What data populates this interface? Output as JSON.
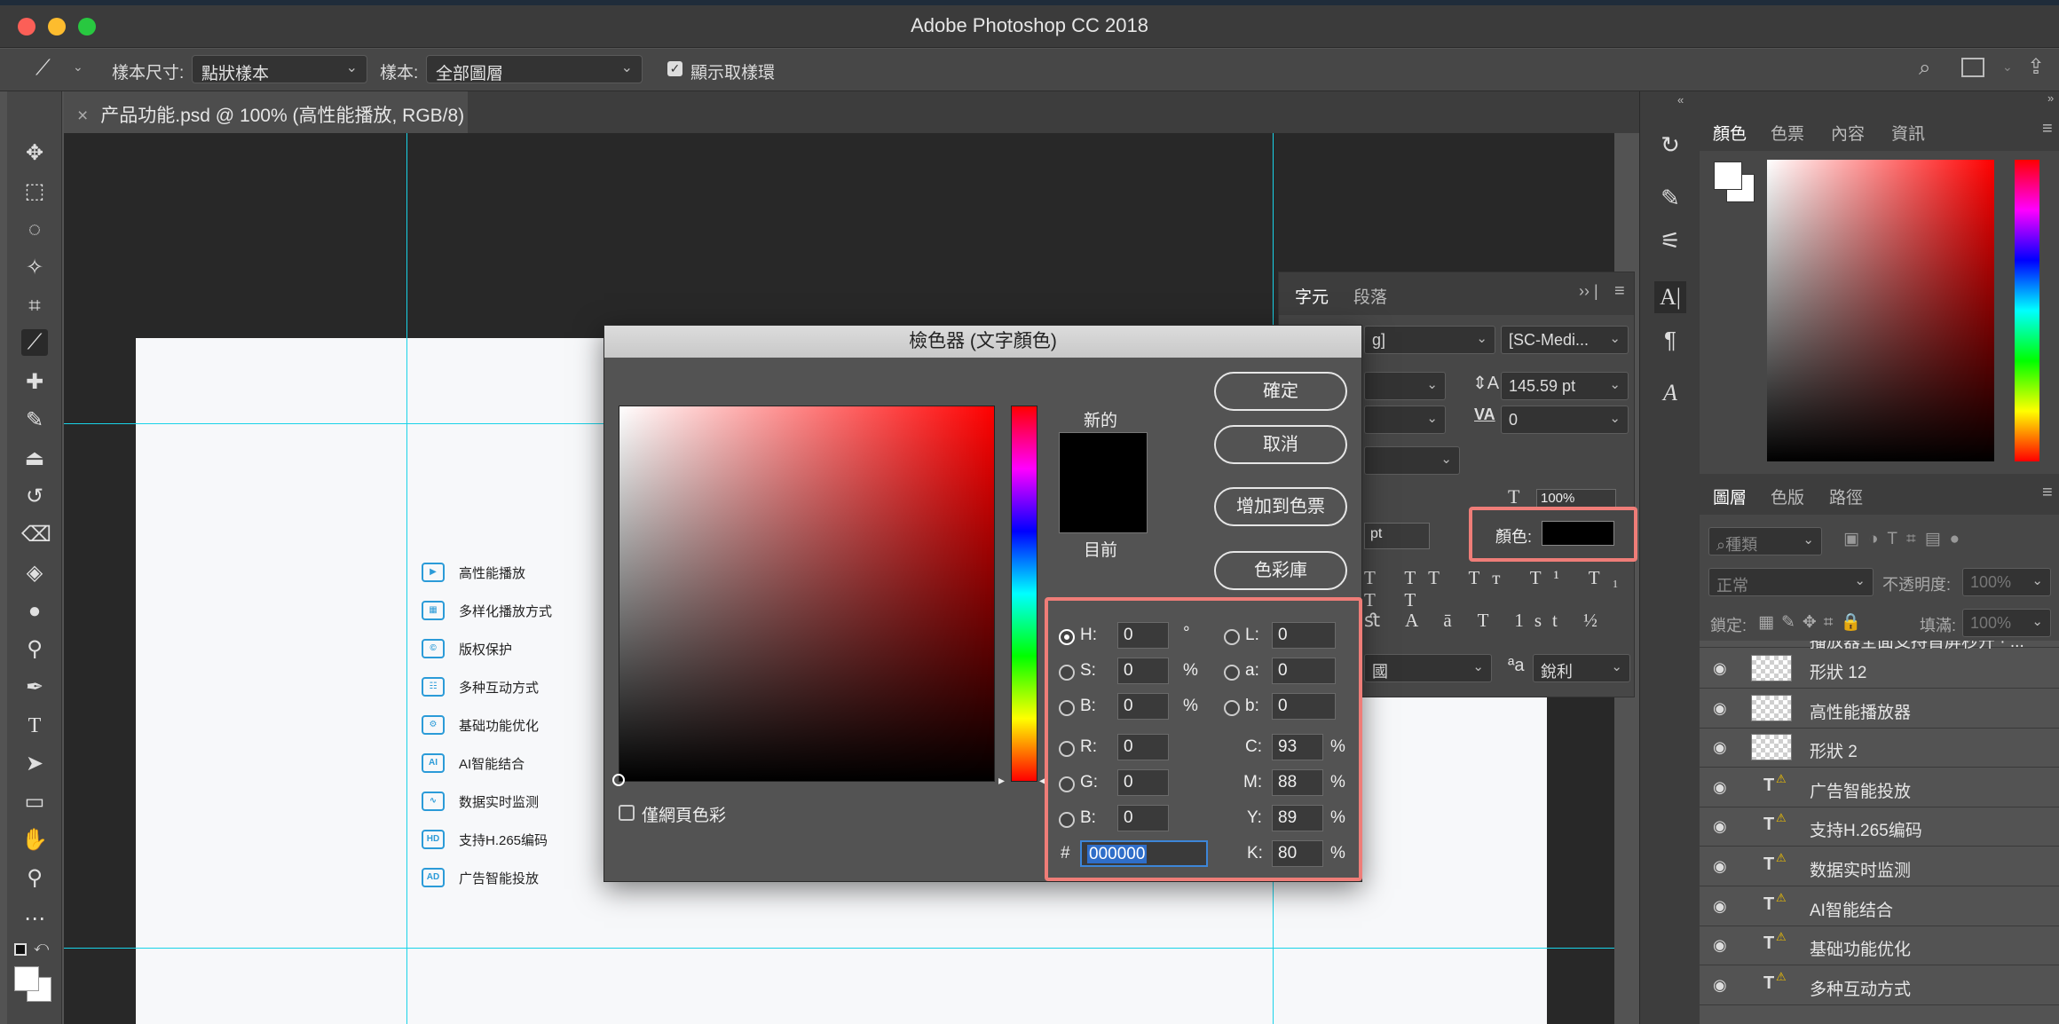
{
  "app_title": "Adobe Photoshop CC 2018",
  "options_bar": {
    "sample_size_label": "樣本尺寸:",
    "sample_size_value": "點狀樣本",
    "sample_label": "樣本:",
    "sample_value": "全部圖層",
    "show_ring_label": "顯示取樣環"
  },
  "document_tab": "产品功能.psd @ 100% (高性能播放, RGB/8)",
  "features": [
    {
      "icon": "▶",
      "label": "高性能播放"
    },
    {
      "icon": "▦",
      "label": "多样化播放方式"
    },
    {
      "icon": "©",
      "label": "版权保护"
    },
    {
      "icon": "☷",
      "label": "多种互动方式"
    },
    {
      "icon": "⚙",
      "label": "基础功能优化"
    },
    {
      "icon": "AI",
      "label": "AI智能结合"
    },
    {
      "icon": "∿",
      "label": "数据实时监测"
    },
    {
      "icon": "HD",
      "label": "支持H.265编码"
    },
    {
      "icon": "AD",
      "label": "广告智能投放"
    }
  ],
  "color_picker": {
    "title": "檢色器 (文字顏色)",
    "new_label": "新的",
    "current_label": "目前",
    "ok": "確定",
    "cancel": "取消",
    "add_swatch": "增加到色票",
    "color_library": "色彩庫",
    "web_only": "僅網頁色彩",
    "fields": {
      "H": "0",
      "S": "0",
      "B": "0",
      "R": "0",
      "G": "0",
      "B2": "0",
      "L": "0",
      "a": "0",
      "b": "0",
      "C": "93",
      "M": "88",
      "Y": "89",
      "K": "80"
    },
    "labels": {
      "H": "H:",
      "S": "S:",
      "B": "B:",
      "R": "R:",
      "G": "G:",
      "B2": "B:",
      "L": "L:",
      "a": "a:",
      "b": "b:",
      "C": "C:",
      "M": "M:",
      "Y": "Y:",
      "K": "K:"
    },
    "units": {
      "deg": "°",
      "pct": "%"
    },
    "hex": "000000",
    "hex_label": "#"
  },
  "character_panel": {
    "tabs": [
      "字元",
      "段落"
    ],
    "font_family_partial": "g]",
    "font_style": "[SC-Medi...",
    "leading": "145.59 pt",
    "tracking": "0",
    "scale": "100%",
    "size_partial": "pt",
    "color_label": "顏色:",
    "color_value": "#000000",
    "lang_partial": "國",
    "aa_label": "a",
    "aa_value": "銳利"
  },
  "color_panel": {
    "tabs": [
      "顏色",
      "色票",
      "內容",
      "資訊"
    ]
  },
  "layers_panel": {
    "tabs": [
      "圖層",
      "色版",
      "路徑"
    ],
    "filter_label": "種類",
    "blend_mode": "正常",
    "opacity_label": "不透明度:",
    "opacity_value": "100%",
    "lock_label": "鎖定:",
    "fill_label": "填滿:",
    "fill_value": "100%",
    "partial_top_layer": "播放器全面支持首屏秒开 · ...",
    "layers": [
      {
        "name": "形狀 12",
        "kind": "shape"
      },
      {
        "name": "高性能播放器",
        "kind": "smart"
      },
      {
        "name": "形狀 2",
        "kind": "shape"
      },
      {
        "name": "广告智能投放",
        "kind": "text"
      },
      {
        "name": "支持H.265编码",
        "kind": "text"
      },
      {
        "name": "数据实时监测",
        "kind": "text"
      },
      {
        "name": "AI智能结合",
        "kind": "text"
      },
      {
        "name": "基础功能优化",
        "kind": "text"
      },
      {
        "name": "多种互动方式",
        "kind": "text"
      }
    ]
  }
}
